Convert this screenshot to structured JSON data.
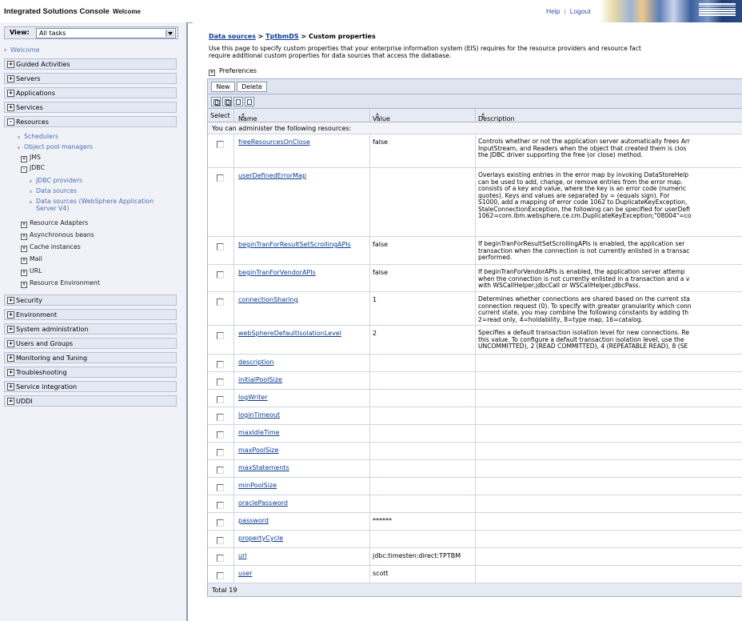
{
  "banner": {
    "title": "Integrated Solutions Console",
    "subtitle": "Welcome",
    "help": "Help",
    "logout": "Logout",
    "brand": "IBM"
  },
  "nav": {
    "view_label": "View:",
    "view_value": "All tasks",
    "welcome": "Welcome",
    "top_items": [
      {
        "label": "Guided Activities",
        "state": "+"
      },
      {
        "label": "Servers",
        "state": "+"
      },
      {
        "label": "Applications",
        "state": "+"
      },
      {
        "label": "Services",
        "state": "+"
      },
      {
        "label": "Resources",
        "state": "-"
      }
    ],
    "resources": {
      "schedulers": "Schedulers",
      "object_pool": "Object pool managers",
      "jms": "JMS",
      "jdbc": "JDBC",
      "jdbc_providers": "JDBC providers",
      "data_sources": "Data sources",
      "data_sources_v4_line1": "Data sources (WebSphere Application",
      "data_sources_v4_line2": "Server V4)",
      "resource_adapters": "Resource Adapters",
      "async_beans": "Asynchronous beans",
      "cache": "Cache instances",
      "mail": "Mail",
      "url": "URL",
      "resource_env": "Resource Environment"
    },
    "bottom_items": [
      {
        "label": "Security",
        "state": "+"
      },
      {
        "label": "Environment",
        "state": "+"
      },
      {
        "label": "System administration",
        "state": "+"
      },
      {
        "label": "Users and Groups",
        "state": "+"
      },
      {
        "label": "Monitoring and Tuning",
        "state": "+"
      },
      {
        "label": "Troubleshooting",
        "state": "+"
      },
      {
        "label": "Service integration",
        "state": "+"
      },
      {
        "label": "UDDI",
        "state": "+"
      }
    ]
  },
  "content": {
    "breadcrumb": {
      "part1": "Data sources",
      "sep": ">",
      "part2": "TptbmDS",
      "sep2": ">",
      "current": "Custom properties"
    },
    "intro_line1": "Use this page to specify custom properties that your enterprise information system (EIS) requires for the resource providers and resource fact",
    "intro_line2": "require additional custom properties for data sources that access the database.",
    "preferences": "Preferences",
    "buttons": {
      "new": "New",
      "delete": "Delete"
    },
    "headers": {
      "select": "Select",
      "name": "Name",
      "value": "Value",
      "description": "Description"
    },
    "notice": "You can administer the following resources:",
    "rows": [
      {
        "name": "freeResourcesOnClose",
        "value": "false",
        "desc": [
          "Controls whether or not the application server automatically frees Arr",
          "InputStream, and Readers when the object that created them is clos",
          "the JDBC driver supporting the free (or close) method."
        ]
      },
      {
        "name": "userDefinedErrorMap",
        "value": "",
        "desc": [
          "Overlays existing entries in the error map by invoking DataStoreHelp",
          "can be used to add, change, or remove entries from the error map.",
          "consists of a key and value, where the key is an error code (numeric",
          "quotes). Keys and values are separated by = (equals sign). For",
          "S1000, add a mapping of error code 1062 to DuplicateKeyException,",
          "StaleConnectionException, the following can be specified for userDefi",
          "1062=com.ibm.websphere.ce.cm.DuplicateKeyException;\"08004\"=co"
        ]
      },
      {
        "name": "beginTranForResultSetScrollingAPIs",
        "value": "false",
        "desc": [
          "If beginTranForResultSetScrollingAPIs is enabled, the application ser",
          "transaction when the connection is not currently enlisted in a transac",
          "performed."
        ]
      },
      {
        "name": "beginTranForVendorAPIs",
        "value": "false",
        "desc": [
          "If beginTranForVendorAPIs is enabled, the application server attemp",
          "when the connection is not currently enlisted in a transaction and a v",
          "with WSCallHelper.jdbcCall or WSCallHelper.jdbcPass."
        ]
      },
      {
        "name": "connectionSharing",
        "value": "1",
        "desc": [
          "Determines whether connections are shared based on the current sta",
          "connection request (0). To specify with greater granularity which conn",
          "current state, you may combine the following constants by adding th",
          "2=read only, 4=holdability, 8=type map, 16=catalog."
        ]
      },
      {
        "name": "webSphereDefaultIsolationLevel",
        "value": "2",
        "desc": [
          "Specifies a default transaction isolation level for new connections. Re",
          "this value. To configure a default transaction isolation level, use the",
          "UNCOMMITTED), 2 (READ COMMITTED), 4 (REPEATABLE READ), 8 (SE"
        ]
      },
      {
        "name": "description",
        "value": "",
        "desc": []
      },
      {
        "name": "initialPoolSize",
        "value": "",
        "desc": []
      },
      {
        "name": "logWriter",
        "value": "",
        "desc": []
      },
      {
        "name": "loginTimeout",
        "value": "",
        "desc": []
      },
      {
        "name": "maxIdleTime",
        "value": "",
        "desc": []
      },
      {
        "name": "maxPoolSize",
        "value": "",
        "desc": []
      },
      {
        "name": "maxStatements",
        "value": "",
        "desc": []
      },
      {
        "name": "minPoolSize",
        "value": "",
        "desc": []
      },
      {
        "name": "oraclePassword",
        "value": "",
        "desc": []
      },
      {
        "name": "password",
        "value": "******",
        "desc": []
      },
      {
        "name": "propertyCycle",
        "value": "",
        "desc": []
      },
      {
        "name": "url",
        "value": "jdbc:timesten:direct:TPTBM",
        "desc": []
      },
      {
        "name": "user",
        "value": "scott",
        "desc": []
      }
    ],
    "total": "Total 19"
  }
}
